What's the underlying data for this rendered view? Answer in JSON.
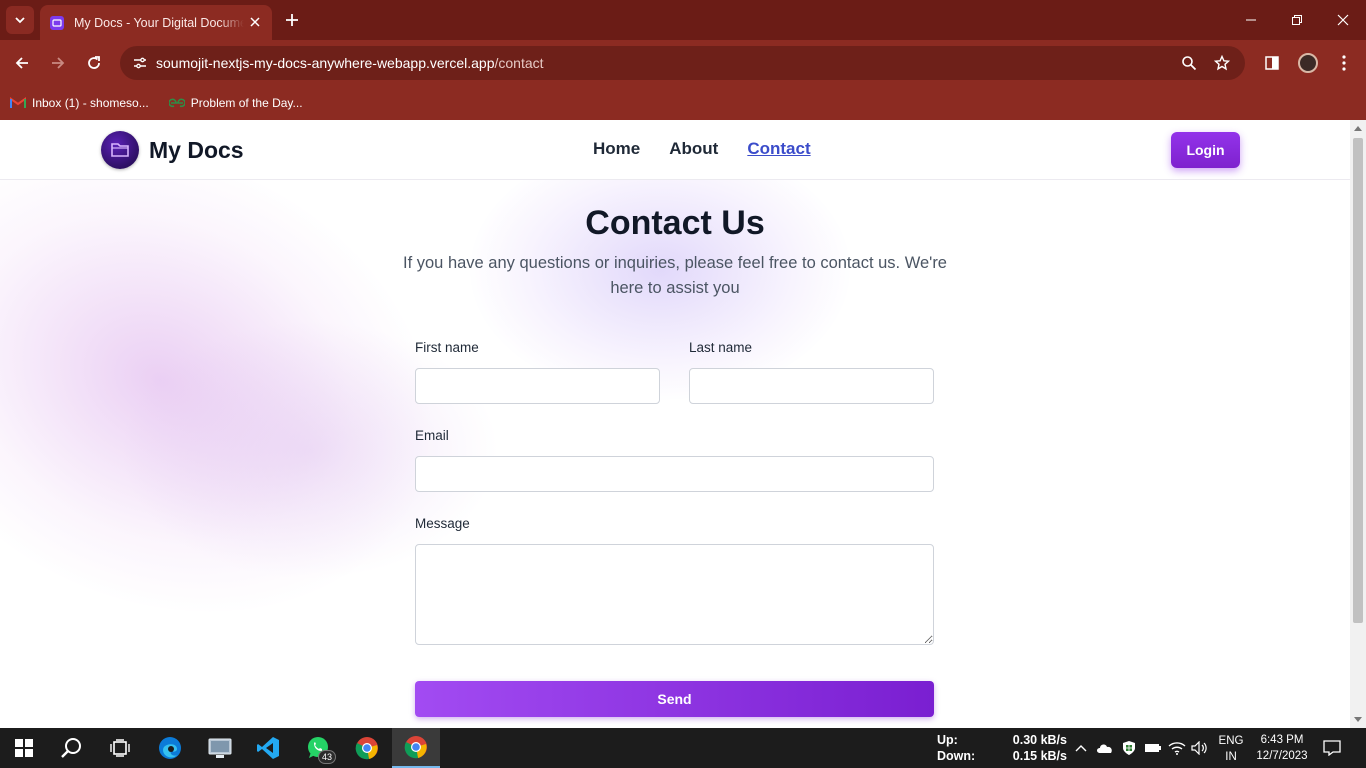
{
  "browser": {
    "tab_title": "My Docs - Your Digital Docume",
    "url_host": "soumojit-nextjs-my-docs-anywhere-webapp.vercel.app",
    "url_path": "/contact",
    "bookmarks": [
      {
        "label": "Inbox (1) - shomeso...",
        "icon": "gmail-icon"
      },
      {
        "label": "Problem of the Day...",
        "icon": "geeksforgeeks-icon"
      }
    ],
    "theme_color": "#8c2b22"
  },
  "site": {
    "brand": "My Docs",
    "nav": {
      "home": "Home",
      "about": "About",
      "contact": "Contact"
    },
    "login_label": "Login",
    "accent_color": "#9333ea"
  },
  "contact": {
    "title": "Contact Us",
    "subtitle": "If you have any questions or inquiries, please feel free to contact us. We're here to assist you",
    "first_name_label": "First name",
    "last_name_label": "Last name",
    "email_label": "Email",
    "message_label": "Message",
    "send_label": "Send"
  },
  "taskbar": {
    "netspeed_up_label": "Up:",
    "netspeed_up_value": "0.30 kB/s",
    "netspeed_down_label": "Down:",
    "netspeed_down_value": "0.15 kB/s",
    "lang_line1": "ENG",
    "lang_line2": "IN",
    "time": "6:43 PM",
    "date": "12/7/2023",
    "whatsapp_badge": "43"
  }
}
